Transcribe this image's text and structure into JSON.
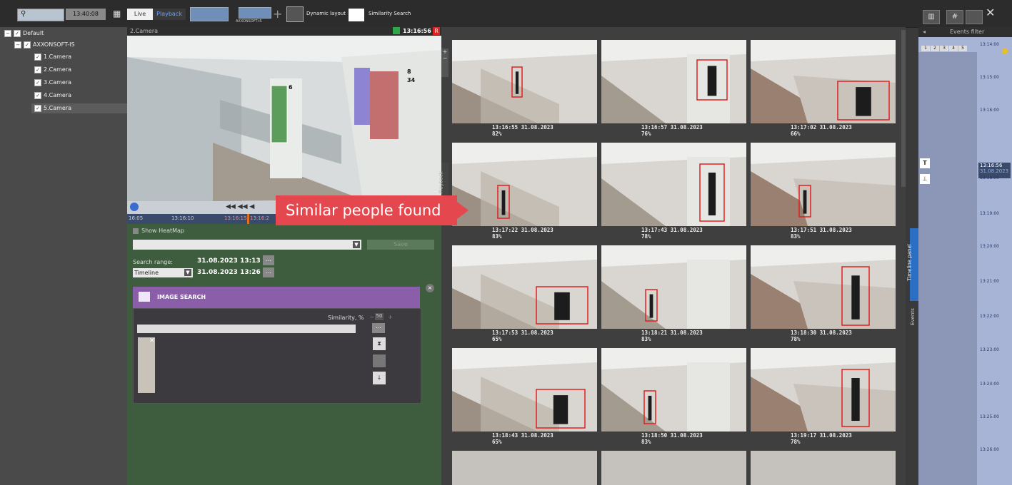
{
  "topbar": {
    "search_time": "13:40:08",
    "live_label": "Live",
    "playback_label": "Playback",
    "layout_name": "AXXONSOFT-IS",
    "dynamic_layout_label": "Dynamic layout",
    "similarity_search_label": "Similarity Search"
  },
  "tree": {
    "root": "Default",
    "server": "AXXONSOFT-IS",
    "cameras": [
      "1.Camera",
      "2.Camera",
      "3.Camera",
      "4.Camera",
      "5.Camera"
    ]
  },
  "camera": {
    "title": "2.Camera",
    "time": "13:16:56",
    "rec_badge": "R",
    "overlay_numbers": [
      "6",
      "8",
      "34"
    ],
    "timeline_ticks": [
      "16:05",
      "13:16:10",
      "13:16:15",
      "13:16:2"
    ]
  },
  "search_panel": {
    "show_heatmap": "Show HeatMap",
    "save_label": "Save",
    "search_range_label": "Search range:",
    "range_from": "31.08.2023 13:13",
    "range_to": "31.08.2023 13:26",
    "range_mode": "Timeline",
    "ellipsis": "...",
    "image_search_title": "IMAGE SEARCH",
    "similarity_label": "Similarity, %",
    "similarity_value": "50"
  },
  "callout": "Similar people found",
  "results": [
    {
      "time": "13:16:55 31.08.2023",
      "score": "82%"
    },
    {
      "time": "13:16:57 31.08.2023",
      "score": "76%"
    },
    {
      "time": "13:17:02 31.08.2023",
      "score": "66%"
    },
    {
      "time": "13:17:22 31.08.2023",
      "score": "83%"
    },
    {
      "time": "13:17:43 31.08.2023",
      "score": "78%"
    },
    {
      "time": "13:17:51 31.08.2023",
      "score": "83%"
    },
    {
      "time": "13:17:53 31.08.2023",
      "score": "65%"
    },
    {
      "time": "13:18:21 31.08.2023",
      "score": "83%"
    },
    {
      "time": "13:18:30 31.08.2023",
      "score": "78%"
    },
    {
      "time": "13:18:43 31.08.2023",
      "score": "65%"
    },
    {
      "time": "13:18:50 31.08.2023",
      "score": "83%"
    },
    {
      "time": "13:19:17 31.08.2023",
      "score": "78%"
    }
  ],
  "side_tabs": {
    "playback": "Playback",
    "timeline_panel": "Timeline panel",
    "events": "Events"
  },
  "events_filter": {
    "title": "Events filter",
    "columns": [
      "1",
      "2",
      "3",
      "4",
      "5"
    ],
    "current_time": "13:16:56",
    "current_date": "31.08.2023",
    "time_marks": [
      "13:14:00",
      "13:15:00",
      "13:16:00",
      "13:18:00",
      "13:19:00",
      "13:20:00",
      "13:21:00",
      "13:22:00",
      "13:23:00",
      "13:24:00",
      "13:25:00",
      "13:26:00"
    ]
  },
  "colors": {
    "accent_red": "#e5474e",
    "image_search_purple": "#8a5ea8",
    "timeline_blue": "#2b6fc4"
  }
}
